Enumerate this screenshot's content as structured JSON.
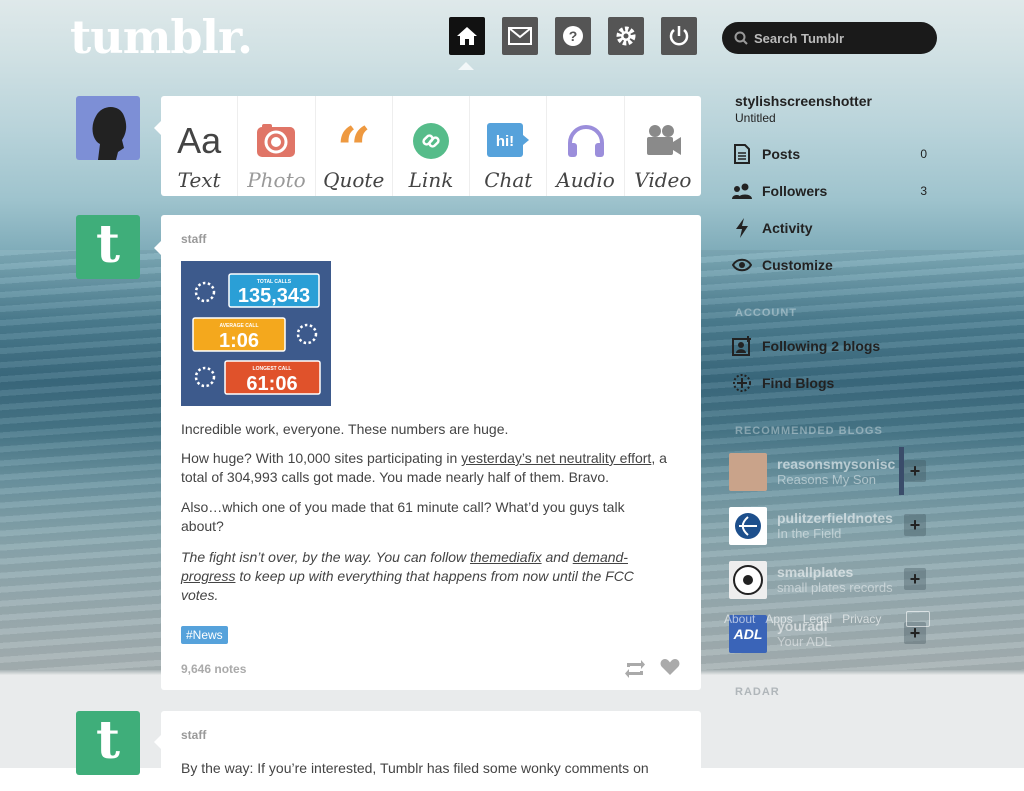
{
  "header": {
    "logo": "tumblr.",
    "search_placeholder": "Search Tumblr",
    "nav": [
      "home-icon",
      "mail-icon",
      "help-icon",
      "gear-icon",
      "power-icon"
    ]
  },
  "post_types": [
    {
      "label": "Text",
      "icon": "text-icon"
    },
    {
      "label": "Photo",
      "icon": "camera-icon"
    },
    {
      "label": "Quote",
      "icon": "quote-icon"
    },
    {
      "label": "Link",
      "icon": "link-icon"
    },
    {
      "label": "Chat",
      "icon": "chat-icon"
    },
    {
      "label": "Audio",
      "icon": "headphones-icon"
    },
    {
      "label": "Video",
      "icon": "video-camera-icon"
    }
  ],
  "post_types_labels": {
    "text": "Text",
    "photo": "Photo",
    "quote": "Quote",
    "link": "Link",
    "chat": "Chat",
    "audio": "Audio",
    "video": "Video"
  },
  "post1": {
    "author": "staff",
    "image": {
      "total_label": "TOTAL CALLS",
      "total_value": "135,343",
      "avg_label": "AVERAGE CALL",
      "avg_value": "1:06",
      "longest_label": "LONGEST CALL",
      "longest_value": "61:06"
    },
    "p1": "Incredible work, everyone. These numbers are huge.",
    "p2_a": "How huge? With 10,000 sites participating in ",
    "p2_link": "yesterday’s net neutrality effort",
    "p2_b": ", a total of 304,993 calls got made. You made nearly half of them. Bravo.",
    "p3": "Also…which one of you made that 61 minute call? What’d you guys talk about?",
    "p4_a": "The fight isn’t over, by the way. You can follow ",
    "p4_link1": "themediafix",
    "p4_b": " and ",
    "p4_link2": "demand-progress",
    "p4_c": " to keep up with everything that happens from now until the FCC votes.",
    "tag": "#News",
    "notes": "9,646 notes"
  },
  "post2": {
    "author": "staff",
    "excerpt": "By the way: If you’re interested, Tumblr has filed some wonky comments on"
  },
  "sidebar": {
    "blog_name": "stylishscreenshotter",
    "blog_title": "Untitled",
    "items": [
      {
        "label": "Posts",
        "count": "0",
        "icon": "posts-icon"
      },
      {
        "label": "Followers",
        "count": "3",
        "icon": "followers-icon"
      },
      {
        "label": "Activity",
        "count": "",
        "icon": "activity-icon"
      },
      {
        "label": "Customize",
        "count": "",
        "icon": "eye-icon"
      }
    ],
    "section_account": "ACCOUNT",
    "following": "Following 2 blogs",
    "find_blogs": "Find Blogs",
    "section_recommended": "RECOMMENDED BLOGS",
    "recommended": [
      {
        "name": "reasonsmysonisc",
        "sub": "Reasons My Son"
      },
      {
        "name": "pulitzerfieldnotes",
        "sub": "In the Field"
      },
      {
        "name": "smallplates",
        "sub": "small plates records"
      },
      {
        "name": "youradl",
        "sub": "Your ADL"
      }
    ],
    "section_radar": "RADAR",
    "footer": [
      "About",
      "Apps",
      "Legal",
      "Privacy"
    ]
  }
}
